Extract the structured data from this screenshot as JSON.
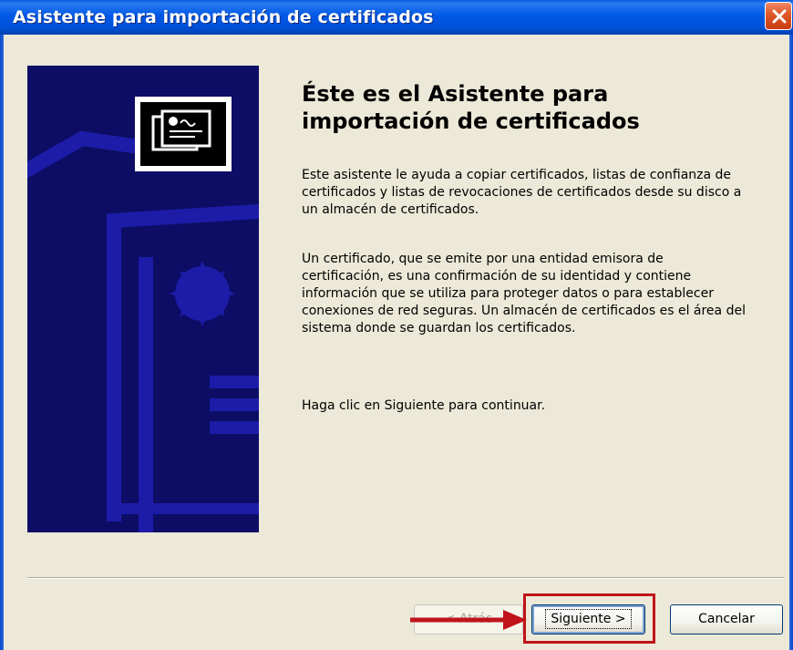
{
  "window": {
    "title": "Asistente para importación de certificados",
    "close_icon": "close-icon"
  },
  "side_panel": {
    "icon": "certificate-icon",
    "seal": "seal-icon"
  },
  "content": {
    "heading": "Éste es el Asistente para importación de certificados",
    "paragraph1": "Este asistente le ayuda a copiar certificados, listas de confianza de certificados y listas de revocaciones de certificados desde su disco a un almacén de certificados.",
    "paragraph2": "Un certificado, que se emite por una entidad emisora de certificación, es una confirmación de su identidad y contiene información que se utiliza para proteger datos o para establecer conexiones de red seguras. Un almacén de certificados es el área del sistema donde se guardan los certificados.",
    "paragraph3": "Haga clic en Siguiente para continuar."
  },
  "buttons": {
    "back": "< Atrás",
    "next": "Siguiente >",
    "cancel": "Cancelar"
  },
  "annotation": {
    "arrow_icon": "arrow-right-icon",
    "color": "#c0141a"
  },
  "colors": {
    "titlebar": "#0058e6",
    "side_panel": "#0d0d66",
    "background": "#ece9d8"
  }
}
